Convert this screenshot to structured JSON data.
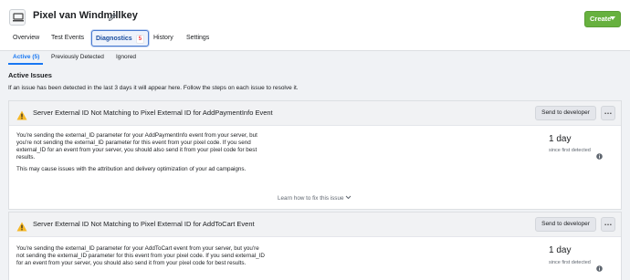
{
  "header": {
    "pixel_name": "Pixel van Windmillkey",
    "create_label": "Create"
  },
  "tabs": [
    {
      "label": "Overview"
    },
    {
      "label": "Test Events"
    },
    {
      "label": "Diagnostics",
      "badge": "5"
    },
    {
      "label": "History"
    },
    {
      "label": "Settings"
    }
  ],
  "subtabs": [
    {
      "label": "Active (5)"
    },
    {
      "label": "Previously Detected"
    },
    {
      "label": "Ignored"
    }
  ],
  "section": {
    "heading": "Active Issues",
    "description": "If an issue has been detected in the last 3 days it will appear here. Follow the steps on each issue to resolve it."
  },
  "issues": [
    {
      "title": "Server External ID Not Matching to Pixel External ID for AddPaymentInfo Event",
      "body_1": "You're sending the external_ID parameter for your AddPaymentInfo event from your server, but you're not sending the external_ID parameter for this event from your pixel code. If you send external_ID for an event from your server, you should also send it from your pixel code for best results.",
      "body_2": "This may cause issues with the attribution and delivery optimization of your ad campaigns.",
      "days": "1 day",
      "since": "since first detected",
      "learn": "Learn how to fix this issue",
      "send_label": "Send to developer"
    },
    {
      "title": "Server External ID Not Matching to Pixel External ID for AddToCart Event",
      "body_1": "You're sending the external_ID parameter for your AddToCart event from your server, but you're not sending the external_ID parameter for this event from your pixel code. If you send external_ID for an event from your server, you should also send it from your pixel code for best results.",
      "days": "1 day",
      "since": "since first detected",
      "send_label": "Send to developer"
    }
  ],
  "colors": {
    "accent": "#1877f2",
    "create_green": "#67b13f",
    "warning": "#f7b928",
    "badge_red": "#fa383e"
  },
  "icons": [
    "monitor-icon",
    "pencil-icon",
    "chevron-down-icon",
    "warning-icon",
    "more-icon",
    "info-icon"
  ]
}
